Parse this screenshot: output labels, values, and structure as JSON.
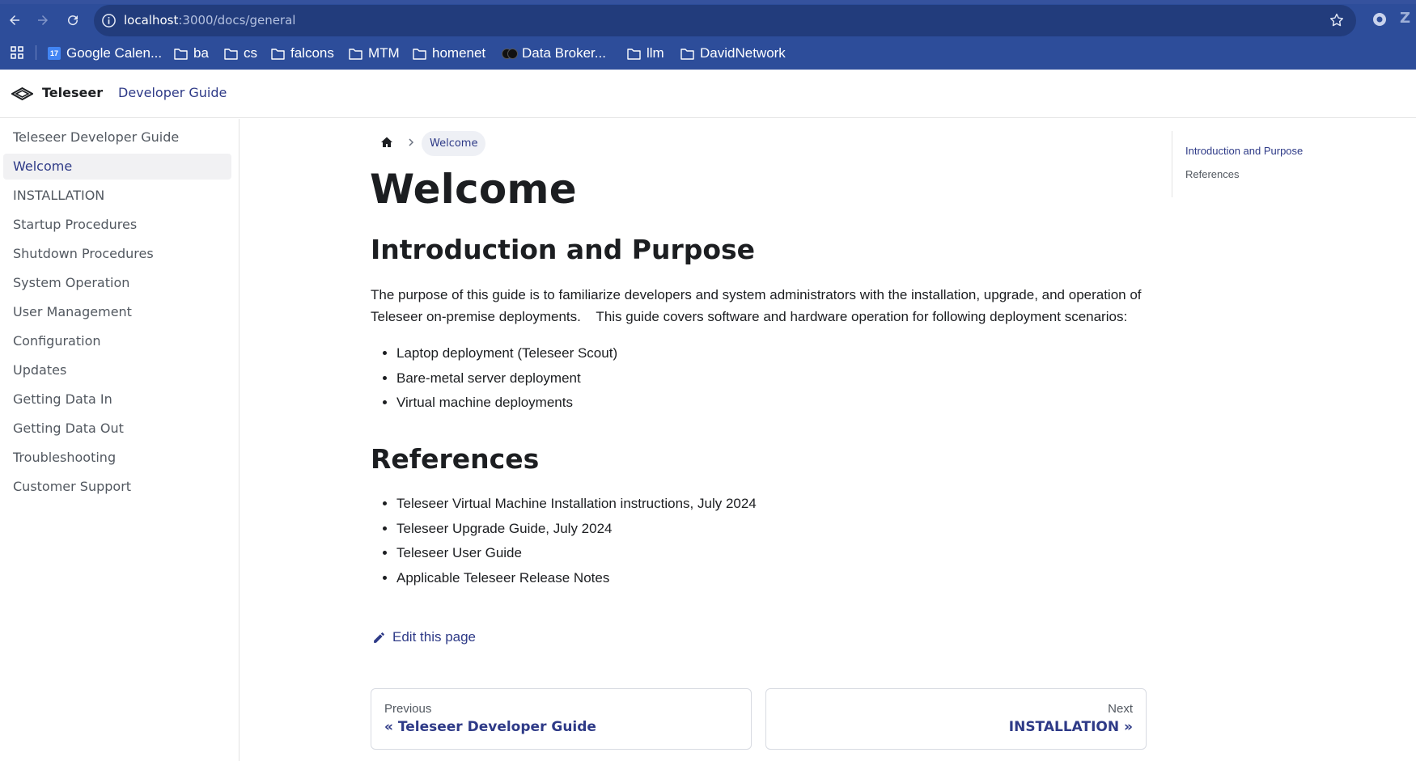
{
  "browser": {
    "url_host": "localhost",
    "url_path": ":3000/docs/general",
    "bookmarks": [
      {
        "label": "Google Calen...",
        "icon": "calendar-icon"
      },
      {
        "label": "ba",
        "icon": "folder-icon"
      },
      {
        "label": "cs",
        "icon": "folder-icon"
      },
      {
        "label": "falcons",
        "icon": "folder-icon"
      },
      {
        "label": "MTM",
        "icon": "folder-icon"
      },
      {
        "label": "homenet",
        "icon": "folder-icon"
      },
      {
        "label": "Data Broker...",
        "icon": "cookie-icon"
      },
      {
        "label": "llm",
        "icon": "folder-icon"
      },
      {
        "label": "DavidNetwork",
        "icon": "folder-icon"
      }
    ],
    "extension_letter": "Z",
    "colors": {
      "chrome_bg": "#2d4d9a",
      "omnibox_bg": "#223c7c"
    }
  },
  "navbar": {
    "brand": "Teleseer",
    "link": "Developer Guide"
  },
  "sidebar": {
    "items": [
      {
        "label": "Teleseer Developer Guide"
      },
      {
        "label": "Welcome",
        "active": true
      },
      {
        "label": "INSTALLATION"
      },
      {
        "label": "Startup Procedures"
      },
      {
        "label": "Shutdown Procedures"
      },
      {
        "label": "System Operation"
      },
      {
        "label": "User Management"
      },
      {
        "label": "Configuration"
      },
      {
        "label": "Updates"
      },
      {
        "label": "Getting Data In"
      },
      {
        "label": "Getting Data Out"
      },
      {
        "label": "Troubleshooting"
      },
      {
        "label": "Customer Support"
      }
    ]
  },
  "breadcrumb": {
    "current": "Welcome"
  },
  "article": {
    "title": "Welcome",
    "intro_heading": "Introduction and Purpose",
    "intro_text": "The purpose of this guide is to familiarize developers and system administrators with the installation, upgrade, and operation of Teleseer on-premise deployments.    This guide covers software and hardware operation for following deployment scenarios:",
    "scenarios": [
      "Laptop deployment (Teleseer Scout)",
      "Bare-metal server deployment",
      "Virtual machine deployments"
    ],
    "references_heading": "References",
    "references": [
      "Teleseer Virtual Machine Installation instructions, July 2024",
      "Teleseer Upgrade Guide, July 2024",
      "Teleseer User Guide",
      "Applicable Teleseer Release Notes"
    ],
    "edit_link": "Edit this page"
  },
  "pager": {
    "prev_sub": "Previous",
    "prev_label": "« Teleseer Developer Guide",
    "next_sub": "Next",
    "next_label": "INSTALLATION »"
  },
  "toc": {
    "items": [
      "Introduction and Purpose",
      "References"
    ]
  },
  "theme": {
    "accent": "#2e3a87",
    "text": "#1c1e21",
    "muted": "#525860"
  }
}
